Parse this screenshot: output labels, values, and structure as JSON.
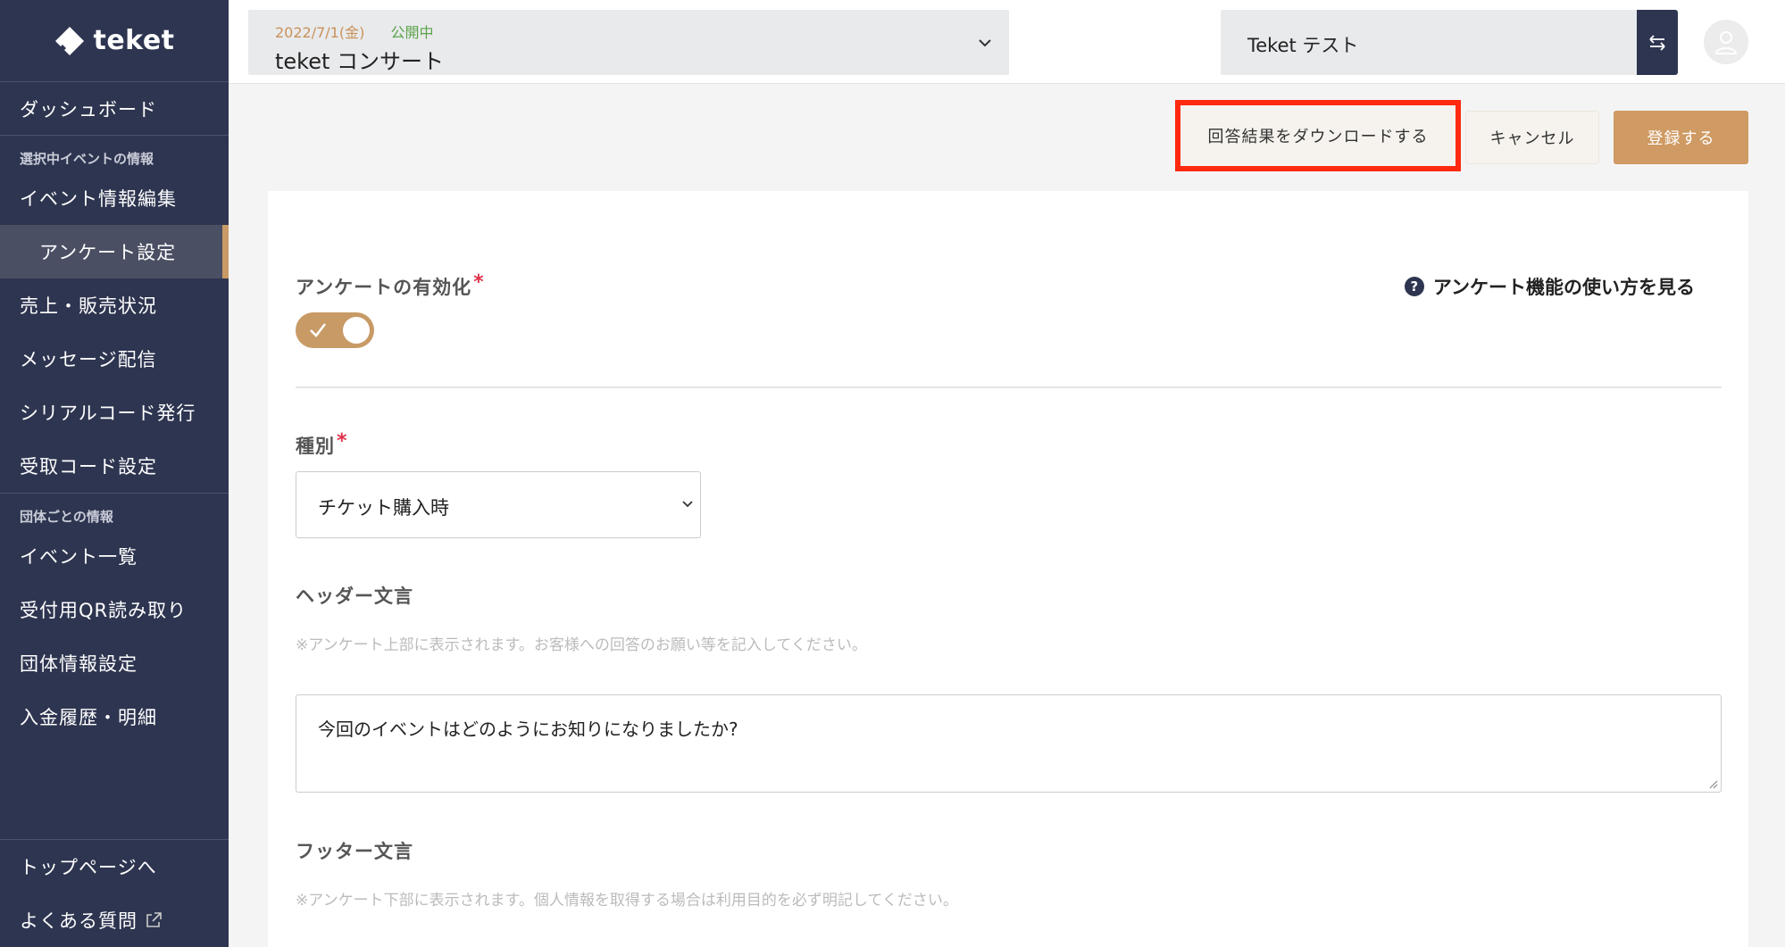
{
  "logo": {
    "text": "teket"
  },
  "sidebar": {
    "top_item": "ダッシュボード",
    "section_event": "選択中イベントの情報",
    "event_items": [
      "イベント情報編集",
      "アンケート設定",
      "売上・販売状況",
      "メッセージ配信",
      "シリアルコード発行",
      "受取コード設定"
    ],
    "active_index": 1,
    "section_org": "団体ごとの情報",
    "org_items": [
      "イベント一覧",
      "受付用QR読み取り",
      "団体情報設定",
      "入金履歴・明細"
    ],
    "bottom_items": [
      "トップページへ",
      "よくある質問"
    ]
  },
  "header": {
    "event_date": "2022/7/1(金)",
    "event_status": "公開中",
    "event_name": "teket コンサート",
    "org_name": "Teket テスト"
  },
  "actions": {
    "download": "回答結果をダウンロードする",
    "cancel": "キャンセル",
    "submit": "登録する"
  },
  "form": {
    "enable_label": "アンケートの有効化",
    "enable_value": true,
    "help_link": "アンケート機能の使い方を見る",
    "type_label": "種別",
    "type_value": "チケット購入時",
    "header_label": "ヘッダー文言",
    "header_hint": "※アンケート上部に表示されます。お客様への回答のお願い等を記入してください。",
    "header_value": "今回のイベントはどのようにお知りになりましたか?",
    "footer_label": "フッター文言",
    "footer_hint": "※アンケート下部に表示されます。個人情報を取得する場合は利用目的を必ず明記してください。"
  },
  "colors": {
    "sidebar_bg": "#2e3550",
    "accent": "#cf9a63",
    "highlight_border": "#ff2a10",
    "required": "#e0334a",
    "status_green": "#5aa34a"
  }
}
